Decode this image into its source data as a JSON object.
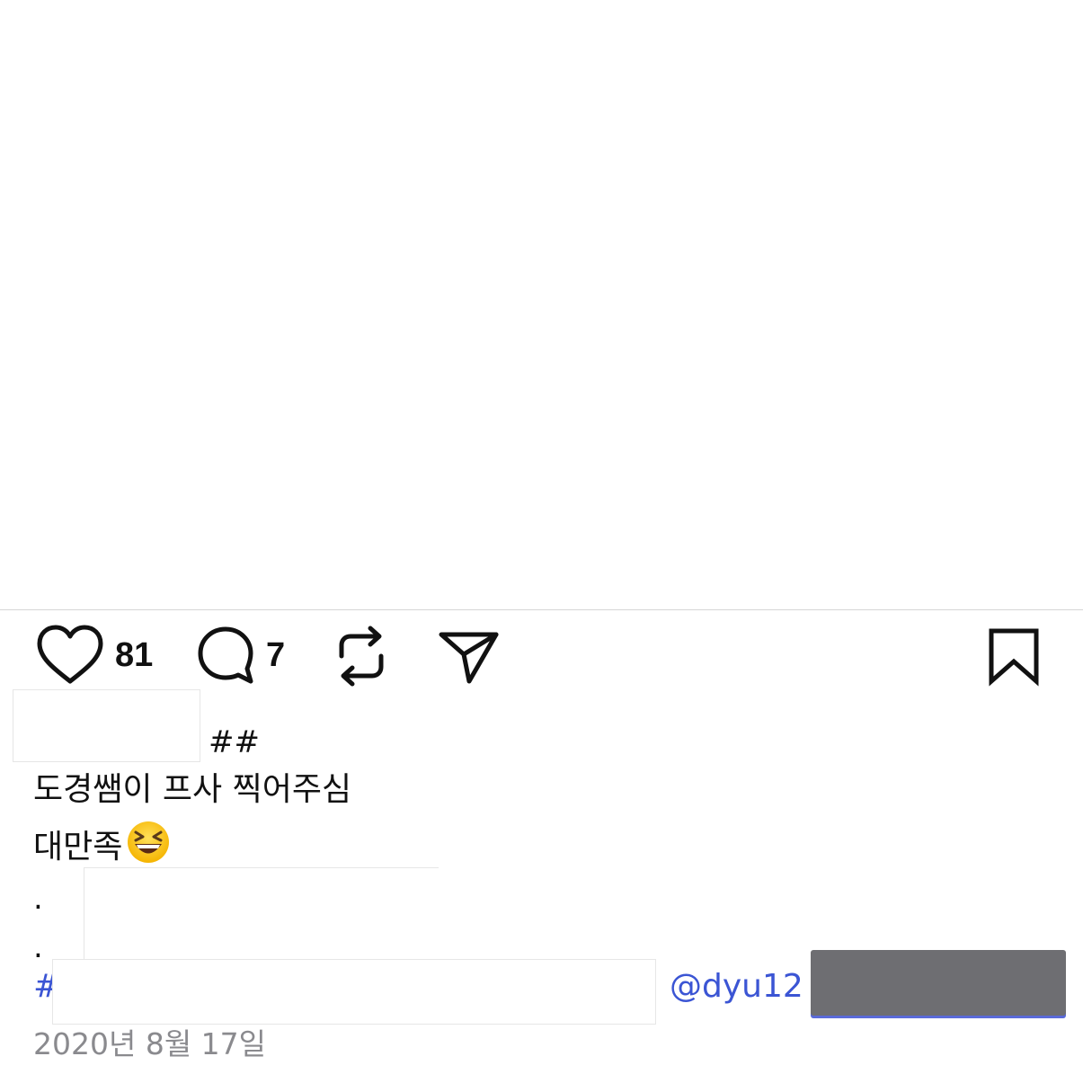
{
  "post": {
    "actions": {
      "like_icon": "heart-outline-icon",
      "like_count": "81",
      "comment_icon": "speech-bubble-icon",
      "comment_count": "7",
      "repost_icon": "repost-arrows-icon",
      "share_icon": "paper-plane-icon",
      "bookmark_icon": "bookmark-outline-icon"
    },
    "caption": {
      "hashes": "##",
      "line1": "도경쌤이 프사 찍어주심",
      "line2": "대만족",
      "emoji_icon": "grinning-squinting-face-icon",
      "dot1": ".",
      "dot2": "."
    },
    "tags": {
      "hashtag_start": "#",
      "mention": "@dyu12"
    },
    "date": "2020년 8월 17일"
  },
  "colors": {
    "link": "#3b55d4",
    "meta_gray": "#8a8a8e",
    "divider": "#d6d6d6",
    "redaction_block": "#6e6e72"
  }
}
